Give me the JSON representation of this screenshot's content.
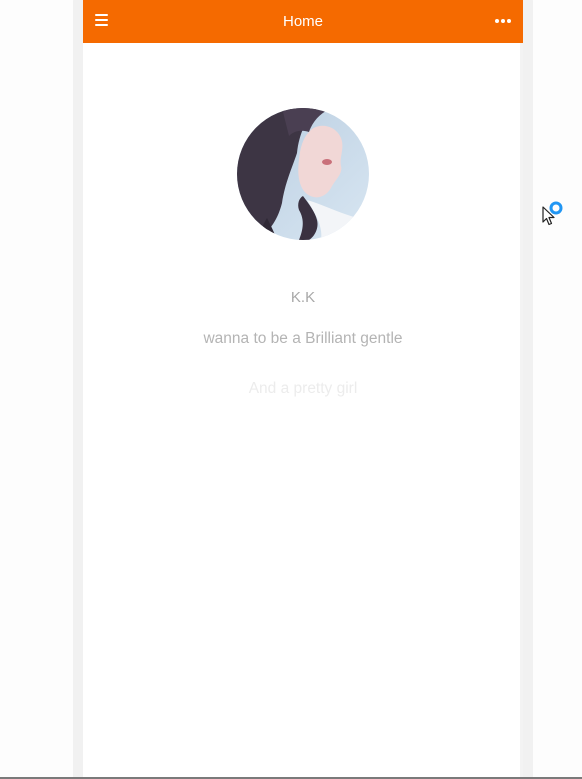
{
  "header": {
    "title": "Home",
    "menu_icon": "hamburger-menu-icon",
    "more_icon": "more-horizontal-icon",
    "background": "#f56a00"
  },
  "profile": {
    "avatar_icon": "profile-photo",
    "name": "K.K",
    "tagline": "wanna to be a Brilliant gentle",
    "subline": "And a pretty girl"
  },
  "colors": {
    "accent": "#f56a00",
    "cursor_spinner": "#2196f3"
  }
}
